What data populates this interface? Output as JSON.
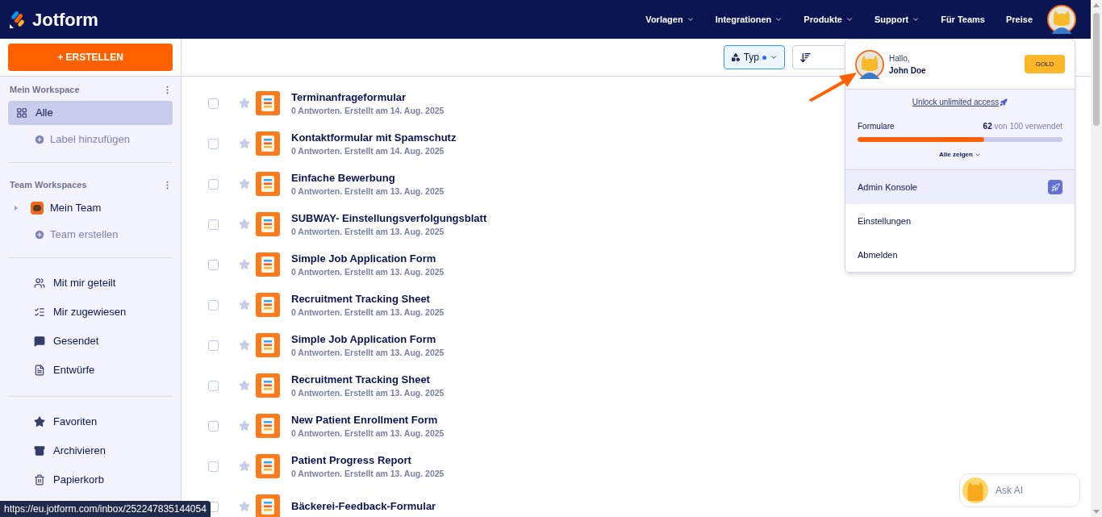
{
  "header": {
    "brand": "Jotform",
    "nav": [
      {
        "label": "Vorlagen",
        "has_menu": true
      },
      {
        "label": "Integrationen",
        "has_menu": true
      },
      {
        "label": "Produkte",
        "has_menu": true
      },
      {
        "label": "Support",
        "has_menu": true
      },
      {
        "label": "Für Teams",
        "has_menu": false
      },
      {
        "label": "Preise",
        "has_menu": false
      }
    ]
  },
  "sidebar": {
    "create_button": "+ ERSTELLEN",
    "sections": [
      {
        "title": "Mein Workspace",
        "items": [
          {
            "kind": "nav",
            "label": "Alle",
            "selected": true
          },
          {
            "kind": "add",
            "label": "Label hinzufügen",
            "selected": false
          }
        ]
      },
      {
        "title": "Team Workspaces",
        "items": [
          {
            "kind": "team",
            "label": "Mein Team",
            "selected": false
          },
          {
            "kind": "add",
            "label": "Team erstellen",
            "selected": false
          }
        ]
      },
      {
        "items": [
          {
            "kind": "nav",
            "label": "Mit mir geteilt",
            "selected": false
          },
          {
            "kind": "nav",
            "label": "Mir zugewiesen",
            "selected": false
          },
          {
            "kind": "nav",
            "label": "Gesendet",
            "selected": false
          },
          {
            "kind": "nav",
            "label": "Entwürfe",
            "selected": false
          }
        ]
      },
      {
        "items": [
          {
            "kind": "nav",
            "label": "Favoriten",
            "selected": false
          },
          {
            "kind": "nav",
            "label": "Archivieren",
            "selected": false
          },
          {
            "kind": "nav",
            "label": "Papierkorb",
            "selected": false
          }
        ]
      }
    ]
  },
  "toolbar": {
    "type_filter": {
      "label": "Typ",
      "active": true
    }
  },
  "forms": [
    {
      "title": "Terminanfrageformular",
      "meta": "0 Antworten. Erstellt am 14. Aug. 2025",
      "checked": false,
      "starred": false
    },
    {
      "title": "Kontaktformular mit Spamschutz",
      "meta": "0 Antworten. Erstellt am 14. Aug. 2025",
      "checked": false,
      "starred": false
    },
    {
      "title": "Einfache Bewerbung",
      "meta": "0 Antworten. Erstellt am 13. Aug. 2025",
      "checked": false,
      "starred": false
    },
    {
      "title": "SUBWAY- Einstellungsverfolgungsblatt",
      "meta": "0 Antworten. Erstellt am 13. Aug. 2025",
      "checked": false,
      "starred": false
    },
    {
      "title": "Simple Job Application Form",
      "meta": "0 Antworten. Erstellt am 13. Aug. 2025",
      "checked": false,
      "starred": false
    },
    {
      "title": "Recruitment Tracking Sheet",
      "meta": "0 Antworten. Erstellt am 13. Aug. 2025",
      "checked": false,
      "starred": false
    },
    {
      "title": "Simple Job Application Form",
      "meta": "0 Antworten. Erstellt am 13. Aug. 2025",
      "checked": false,
      "starred": false
    },
    {
      "title": "Recruitment Tracking Sheet",
      "meta": "0 Antworten. Erstellt am 13. Aug. 2025",
      "checked": false,
      "starred": false
    },
    {
      "title": "New Patient Enrollment Form",
      "meta": "0 Antworten. Erstellt am 13. Aug. 2025",
      "checked": false,
      "starred": false
    },
    {
      "title": "Patient Progress Report",
      "meta": "0 Antworten. Erstellt am 13. Aug. 2025",
      "checked": false,
      "starred": false
    },
    {
      "title": "Bäckerei-Feedback-Formular",
      "checked": false,
      "starred": false
    }
  ],
  "account_menu": {
    "greeting": "Hallo,",
    "name": "John Doe",
    "plan": "GOLD",
    "upgrade_link": "Unlock unlimited access",
    "usage": {
      "label": "Formulare",
      "used": "62",
      "total": "von 100 verwendet",
      "level": 0.62
    },
    "show_all": "Alle zeigen",
    "items": [
      {
        "label": "Admin Konsole",
        "selected": true
      },
      {
        "label": "Einstellungen",
        "selected": false
      },
      {
        "label": "Abmelden",
        "selected": false
      }
    ]
  },
  "ask_ai": "Ask AI",
  "status_url": "https://eu.jotform.com/inbox/252247835144054"
}
